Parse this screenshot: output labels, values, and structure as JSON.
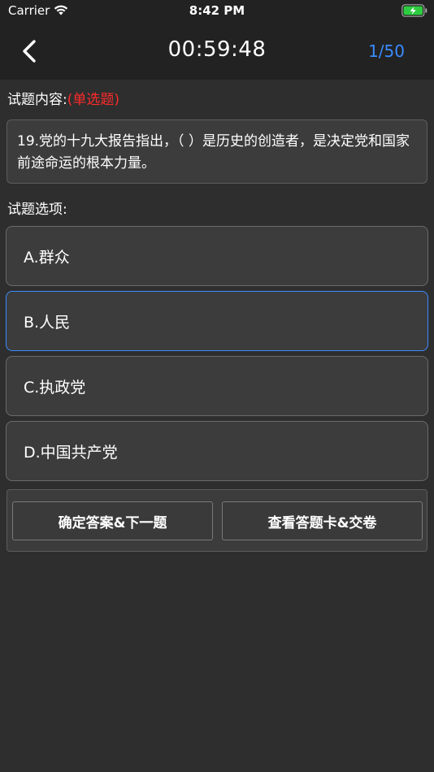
{
  "status_bar": {
    "carrier": "Carrier",
    "time": "8:42 PM",
    "battery_color": "#2ecc40"
  },
  "nav": {
    "back_icon": "chevron-left-icon",
    "timer": "00:59:48",
    "progress": "1/50",
    "accent_color": "#3a8cff"
  },
  "question": {
    "section_label": "试题内容:",
    "type_label": "(单选题)",
    "text": "19.党的十九大报告指出，（ ）是历史的创造者，是决定党和国家前途命运的根本力量。"
  },
  "options": {
    "section_label": "试题选项:",
    "items": [
      {
        "label": "A.群众",
        "selected": false
      },
      {
        "label": "B.人民",
        "selected": true
      },
      {
        "label": "C.执政党",
        "selected": false
      },
      {
        "label": "D.中国共产党",
        "selected": false
      }
    ]
  },
  "actions": {
    "confirm_label": "确定答案&下一题",
    "submit_label": "查看答题卡&交卷"
  }
}
